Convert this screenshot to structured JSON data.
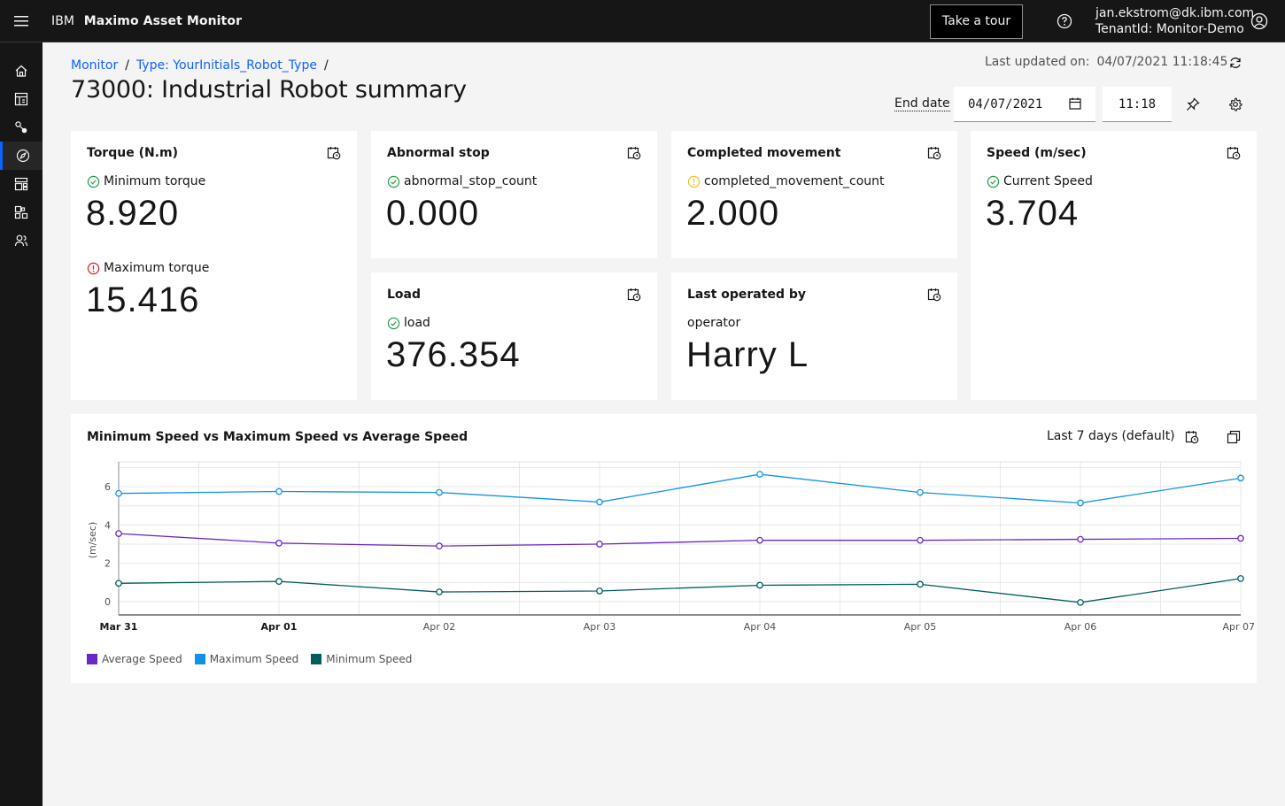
{
  "header": {
    "brand_ibm": "IBM",
    "brand_product": "Maximo Asset Monitor",
    "tour_label": "Take a tour",
    "user_email": "jan.ekstrom@dk.ibm.com",
    "tenant": "TenantId: Monitor-Demo"
  },
  "sidenav": {
    "icons": [
      "home-icon",
      "dashboard-icon",
      "setup-icon",
      "monitor-icon",
      "layout-icon",
      "devices-icon",
      "users-icon"
    ],
    "active": "monitor-icon"
  },
  "breadcrumb": {
    "items": [
      "Monitor",
      "Type: YourInitials_Robot_Type"
    ],
    "separator": "/"
  },
  "page": {
    "title": "73000: Industrial Robot summary",
    "last_updated_label": "Last updated on:",
    "last_updated_value": "04/07/2021 11:18:45",
    "end_date_label": "End date",
    "end_date_value": "04/07/2021",
    "end_time_value": "11:18"
  },
  "cards": {
    "torque": {
      "title": "Torque (N.m)",
      "min_label": "Minimum torque",
      "min_value": "8.920",
      "min_status": "ok",
      "max_label": "Maximum torque",
      "max_value": "15.416",
      "max_status": "alert"
    },
    "abnormal": {
      "title": "Abnormal stop",
      "label": "abnormal_stop_count",
      "value": "0.000",
      "status": "ok"
    },
    "completed": {
      "title": "Completed movement",
      "label": "completed_movement_count",
      "value": "2.000",
      "status": "warning"
    },
    "speed": {
      "title": "Speed (m/sec)",
      "label": "Current Speed",
      "value": "3.704",
      "status": "ok"
    },
    "load": {
      "title": "Load",
      "label": "load",
      "value": "376.354",
      "status": "ok"
    },
    "operator": {
      "title": "Last operated by",
      "label": "operator",
      "value": "Harry L"
    }
  },
  "colors": {
    "ok": "#24a148",
    "alert": "#da1e28",
    "warning": "#f1c21b",
    "link": "#0f62fe"
  },
  "chart": {
    "title": "Minimum Speed vs Maximum Speed vs Average Speed",
    "range_label": "Last 7 days (default)"
  },
  "chart_data": {
    "type": "line",
    "ylabel": "(m/sec)",
    "xlabel": "",
    "ylim": [
      -0.7,
      7.3
    ],
    "yticks": [
      0,
      2,
      4,
      6
    ],
    "x": [
      "Mar 31",
      "Apr 01",
      "Apr 02",
      "Apr 03",
      "Apr 04",
      "Apr 05",
      "Apr 06",
      "Apr 07"
    ],
    "x_bold": [
      "Mar 31",
      "Apr 01"
    ],
    "grid": true,
    "legend_position": "bottom-left",
    "series": [
      {
        "name": "Average Speed",
        "color": "#6929c4",
        "values": [
          3.55,
          3.05,
          2.9,
          3.0,
          3.2,
          3.2,
          3.25,
          3.3
        ]
      },
      {
        "name": "Maximum Speed",
        "color": "#1192e8",
        "values": [
          5.65,
          5.75,
          5.7,
          5.2,
          6.65,
          5.7,
          5.15,
          6.45
        ]
      },
      {
        "name": "Minimum Speed",
        "color": "#005d5d",
        "values": [
          0.95,
          1.05,
          0.5,
          0.55,
          0.85,
          0.9,
          -0.05,
          1.2
        ]
      }
    ]
  }
}
